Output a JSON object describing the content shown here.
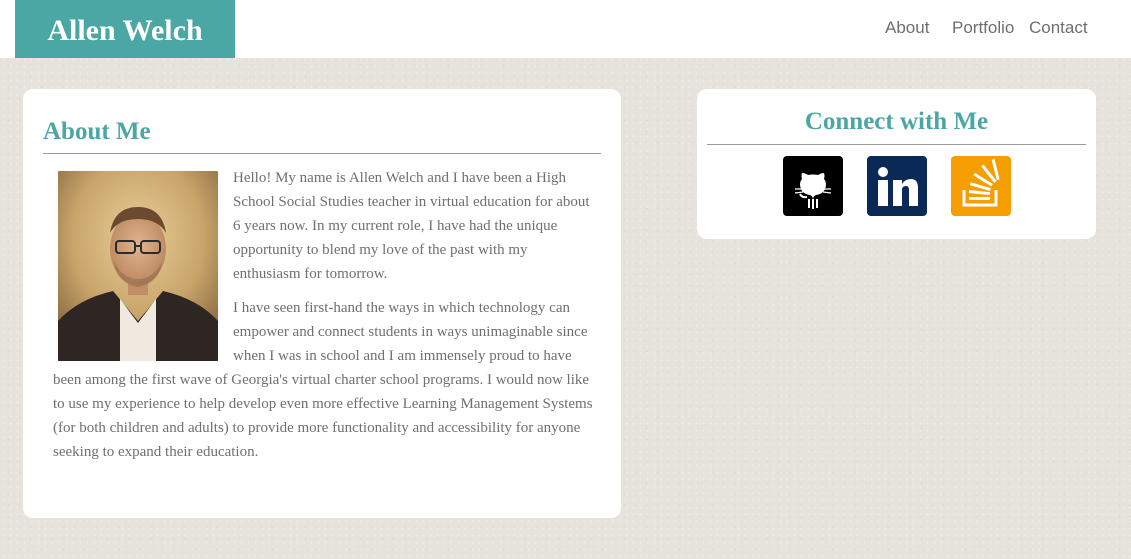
{
  "header": {
    "brand": "Allen Welch",
    "nav": [
      {
        "label": "About"
      },
      {
        "label": "Portfolio"
      },
      {
        "label": "Contact"
      }
    ]
  },
  "about": {
    "title": "About Me",
    "paragraphs": [
      "Hello! My name is Allen Welch and I have been a High School Social Studies teacher in virtual education for about 6 years now. In my current role, I have had the unique opportunity to blend my love of the past with my enthusiasm for tomorrow.",
      "I have seen first-hand the ways in which technology can empower and connect students in ways unimaginable since when I was in school and I am immensely proud to have been among the first wave of Georgia's virtual charter school programs. I would now like to use my experience to help develop even more effective Learning Management Systems (for both children and adults) to provide more functionality and accessibility for anyone seeking to expand their education."
    ]
  },
  "connect": {
    "title": "Connect with Me",
    "links": [
      {
        "icon": "github-icon",
        "color": "#000000"
      },
      {
        "icon": "linkedin-icon",
        "color": "#0b2956"
      },
      {
        "icon": "stackoverflow-icon",
        "color": "#f59e00"
      }
    ]
  },
  "colors": {
    "accent": "#4aa7a3",
    "background": "#e6e2dc",
    "text": "#6f6f6f"
  }
}
